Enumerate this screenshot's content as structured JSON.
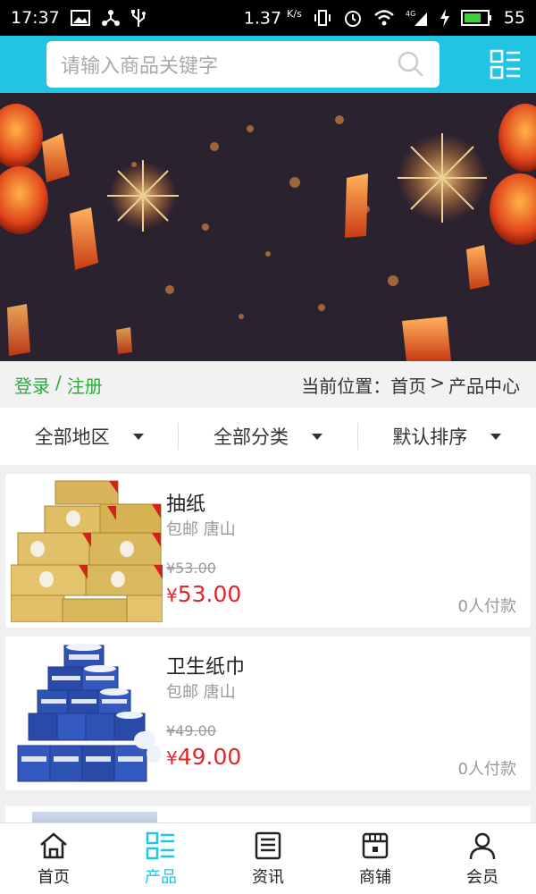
{
  "status_bar": {
    "time": "17:37",
    "network_speed": "1.37",
    "network_unit": "K/s",
    "network_type": "4G",
    "battery": "55",
    "icons": [
      "image-icon",
      "usb-share-icon",
      "usb-icon",
      "vibrate-icon",
      "alarm-icon",
      "wifi-icon",
      "signal-icon",
      "charging-icon",
      "battery-icon"
    ]
  },
  "header": {
    "search_placeholder": "请输入商品关键字",
    "accent_color": "#22c4e4"
  },
  "auth": {
    "login": "登录",
    "separator": "/",
    "register": "注册"
  },
  "breadcrumb": {
    "prefix": "当前位置：",
    "home": "首页",
    "arrow": ">",
    "current": "产品中心"
  },
  "filters": [
    {
      "label": "全部地区"
    },
    {
      "label": "全部分类"
    },
    {
      "label": "默认排序"
    }
  ],
  "products": [
    {
      "name": "抽纸",
      "shipping": "包邮 唐山",
      "old_price": "¥53.00",
      "price_symbol": "¥",
      "price": "53.00",
      "sold": "0人付款"
    },
    {
      "name": "卫生纸巾",
      "shipping": "包邮 唐山",
      "old_price": "¥49.00",
      "price_symbol": "¥",
      "price": "49.00",
      "sold": "0人付款"
    }
  ],
  "nav": [
    {
      "label": "首页",
      "icon": "home-icon"
    },
    {
      "label": "产品",
      "icon": "grid-list-icon",
      "active": true
    },
    {
      "label": "资讯",
      "icon": "news-icon"
    },
    {
      "label": "商铺",
      "icon": "shop-icon"
    },
    {
      "label": "会员",
      "icon": "user-icon"
    }
  ]
}
